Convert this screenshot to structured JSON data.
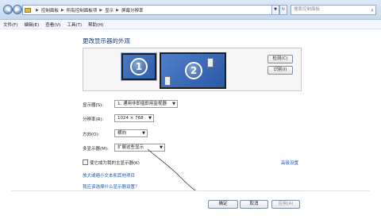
{
  "titlebar": {
    "breadcrumbs": [
      "控制面板",
      "所有控制面板项",
      "显示",
      "屏幕分辨率"
    ],
    "search_placeholder": "搜索控制面板"
  },
  "menubar": [
    "文件(F)",
    "编辑(E)",
    "查看(V)",
    "工具(T)",
    "帮助(H)"
  ],
  "main": {
    "title": "更改显示器的外观",
    "monitors": [
      "1",
      "2"
    ],
    "detect_button": "检测(C)",
    "identify_button": "识别(I)",
    "display_label": "显示器(S):",
    "display_value": "1. 通用非即插即用监视器",
    "resolution_label": "分辨率(R):",
    "resolution_value": "1024 × 768",
    "orientation_label": "方向(O):",
    "orientation_value": "横向",
    "multi_label": "多显示器(M):",
    "multi_value": "扩展这些显示",
    "main_display_checkbox": "使它成为我的主显示器(K)",
    "advanced_link": "高级设置",
    "link_text_size": "放大或缩小文本和其他项目",
    "link_choose": "我应该选择什么显示器设置？"
  },
  "footer": {
    "ok": "确定",
    "cancel": "取消",
    "apply": "应用(A)"
  }
}
